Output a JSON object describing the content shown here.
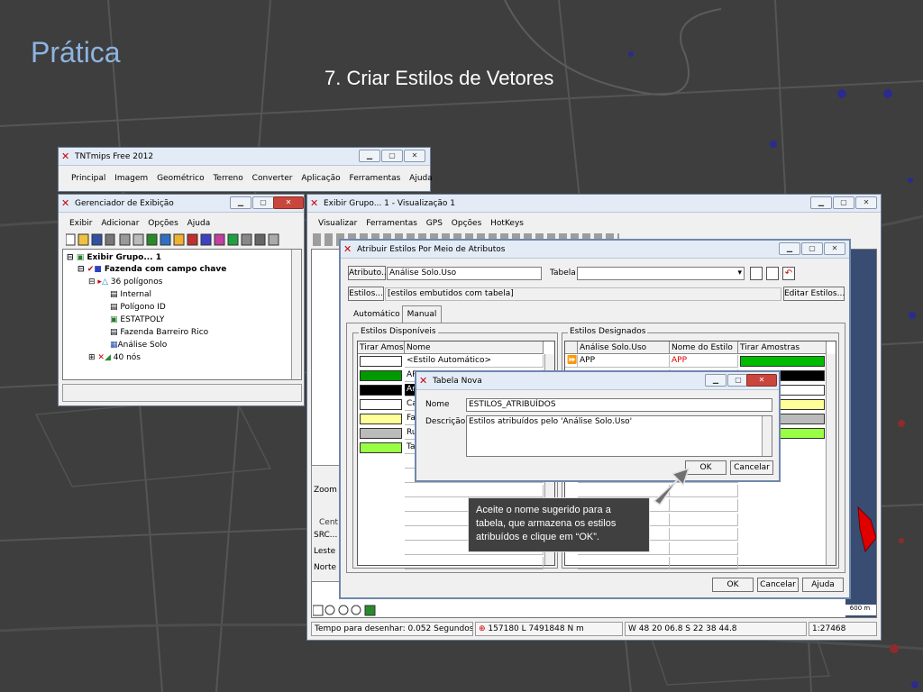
{
  "slide": {
    "title": "Prática",
    "subtitle": "7. Criar Estilos de Vetores"
  },
  "main_window": {
    "title": "TNTmips Free 2012",
    "menu": [
      "Principal",
      "Imagem",
      "Geométrico",
      "Terreno",
      "Converter",
      "Aplicação",
      "Ferramentas",
      "Ajuda"
    ]
  },
  "display_manager": {
    "title": "Gerenciador de Exibição",
    "menu": [
      "Exibir",
      "Adicionar",
      "Opções",
      "Ajuda"
    ],
    "tree": [
      "Exibir Grupo... 1",
      "Fazenda com campo chave",
      "36 polígonos",
      "Internal",
      "Polígono ID",
      "ESTATPOLY",
      "Fazenda Barreiro Rico",
      "Análise Solo",
      "40 nós"
    ]
  },
  "view_window": {
    "title": "Exibir Grupo... 1 - Visualização 1",
    "menu": [
      "Visualizar",
      "Ferramentas",
      "GPS",
      "Opções",
      "HotKeys"
    ],
    "side": {
      "zoom": "Zoom",
      "cent": "Cent",
      "src": "SRC...",
      "leste": "Leste",
      "norte": "Norte"
    },
    "scale_label": "600 m",
    "status": {
      "draw_time": "Tempo para desenhar: 0.052 Segundos",
      "coords": "157180 L  7491848 N m",
      "latlon": "W 48 20 06.8  S 22 38 44.8",
      "scale": "1:27468"
    }
  },
  "assign_dialog": {
    "title": "Atribuir Estilos Por Meio de Atributos",
    "attribute_btn": "Atributo...",
    "attribute_value": "Análise Solo.Uso",
    "table_label": "Tabela",
    "styles_btn": "Estilos...",
    "styles_value": "[estilos embutidos com tabela]",
    "edit_styles_btn": "Editar Estilos...",
    "tabs": [
      "Automático",
      "Manual"
    ],
    "available": {
      "group": "Estilos Disponíveis",
      "headers": [
        "Tirar Amostras",
        "Nome"
      ],
      "rows": [
        {
          "name": "<Estilo Automático>",
          "color": "#ffffff"
        },
        {
          "name": "AP",
          "color": "#009900"
        },
        {
          "name": "Ar",
          "color": "#000000"
        },
        {
          "name": "Ca",
          "color": "#ffffff"
        },
        {
          "name": "Fa",
          "color": "#ffff99"
        },
        {
          "name": "Ru",
          "color": "#bbbbbb"
        },
        {
          "name": "Ta",
          "color": "#99ff44"
        }
      ]
    },
    "assigned": {
      "group": "Estilos Designados",
      "headers": [
        "Análise Solo.Uso",
        "Nome do Estilo",
        "Tirar Amostras"
      ],
      "rows": [
        {
          "uso": "APP",
          "style": "APP",
          "color": "#00bb00"
        }
      ],
      "extra_colors": [
        "#000000",
        "#ffffff",
        "#ffff99",
        "#bbbbbb",
        "#99ff44"
      ]
    },
    "ok": "OK",
    "cancel": "Cancelar",
    "help": "Ajuda"
  },
  "new_table_dialog": {
    "title": "Tabela Nova",
    "name_label": "Nome",
    "name_value": "ESTILOS_ATRIBUÍDOS",
    "desc_label": "Descrição",
    "desc_value": "Estilos atribuídos pelo 'Análise Solo.Uso'",
    "ok": "OK",
    "cancel": "Cancelar"
  },
  "callout": "Aceite o nome sugerido para a tabela, que armazena os estilos atribuídos e clique em “OK”.",
  "colors": {
    "title_blue": "#8db4e2",
    "callout_bg": "#404040"
  }
}
